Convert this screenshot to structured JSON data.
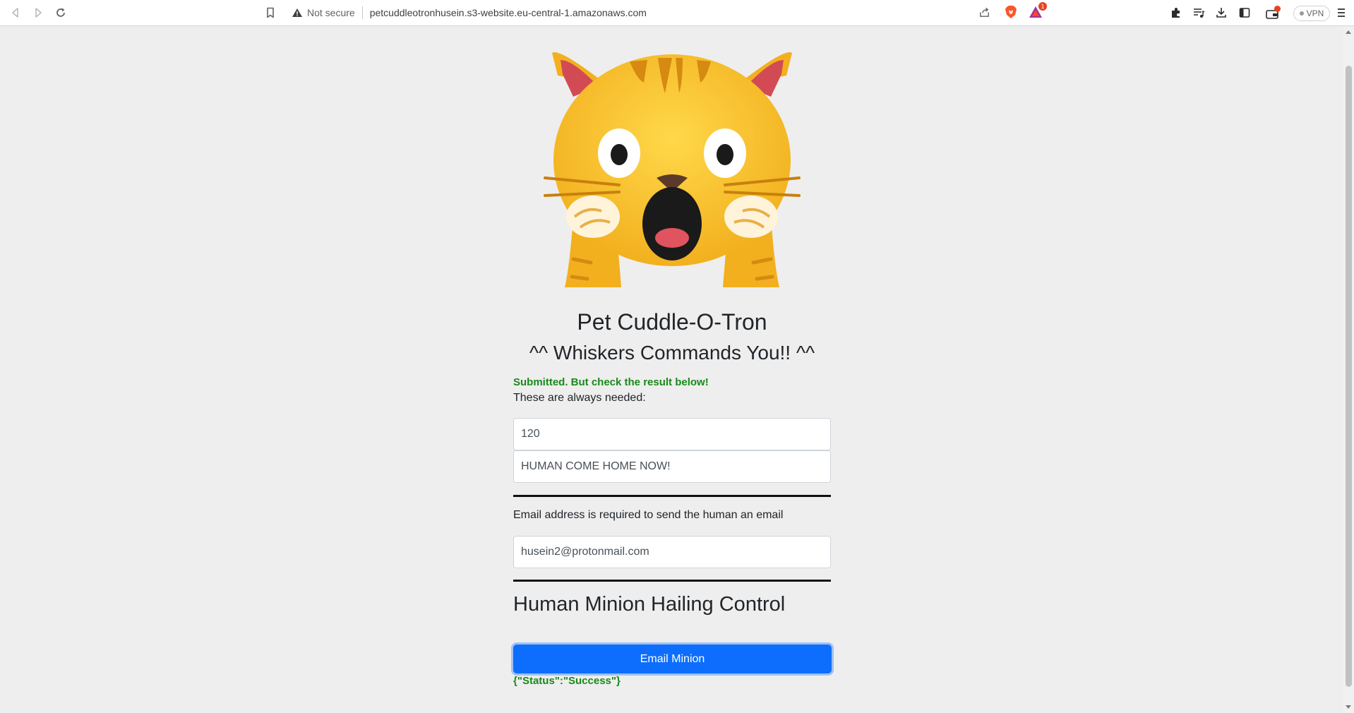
{
  "browser": {
    "security_label": "Not secure",
    "url": "petcuddleotronhusein.s3-website.eu-central-1.amazonaws.com",
    "rewards_badge": "1",
    "vpn_label": "VPN"
  },
  "page": {
    "title": "Pet Cuddle-O-Tron",
    "subtitle": "^^ Whiskers Commands You!! ^^",
    "status_message": "Submitted. But check the result below!",
    "needed_label": "These are always needed:",
    "fields": {
      "wait_value": "120",
      "message_value": "HUMAN COME HOME NOW!",
      "email_value": "husein2@protonmail.com"
    },
    "email_note": "Email address is required to send the human an email",
    "control_title": "Human Minion Hailing Control",
    "email_button_label": "Email Minion",
    "result": "{\"Status\":\"Success\"}"
  },
  "colors": {
    "accent_button": "#0d6efd",
    "success_text": "#198a19",
    "page_background": "#eeeeee"
  },
  "icons": [
    "back-icon",
    "forward-icon",
    "reload-icon",
    "bookmark-icon",
    "warning-icon",
    "share-icon",
    "brave-shields-icon",
    "brave-rewards-icon",
    "extensions-icon",
    "playlist-icon",
    "downloads-icon",
    "sidebar-icon",
    "wallet-icon",
    "menu-icon",
    "weary-cat-emoji"
  ]
}
